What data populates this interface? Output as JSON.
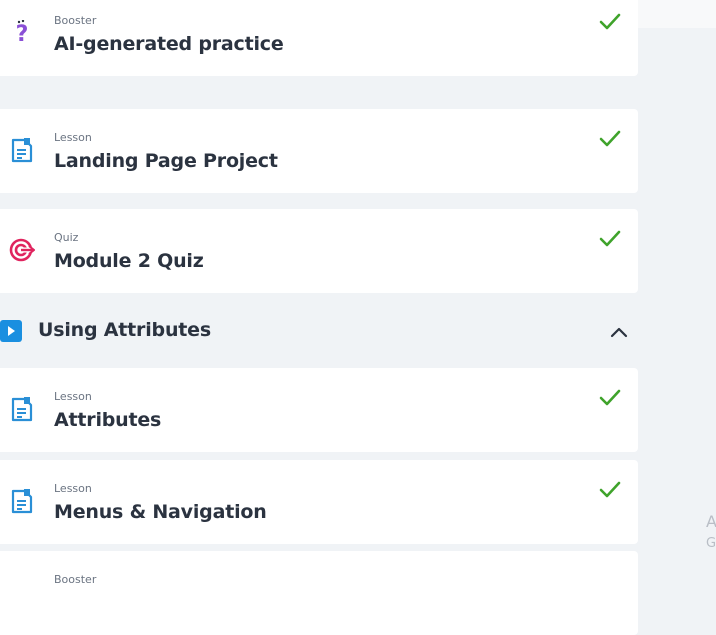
{
  "items": [
    {
      "type": "Booster",
      "title": "AI-generated practice"
    },
    {
      "type": "Lesson",
      "title": "Landing Page Project"
    },
    {
      "type": "Quiz",
      "title": "Module 2 Quiz"
    },
    {
      "type": "Lesson",
      "title": "Attributes"
    },
    {
      "type": "Lesson",
      "title": "Menus & Navigation"
    },
    {
      "type": "Booster",
      "title": ""
    }
  ],
  "section": {
    "title": "Using Attributes"
  },
  "side_text": {
    "line1": "A",
    "line2": "G"
  },
  "colors": {
    "background": "#f0f3f6",
    "card": "#ffffff",
    "check": "#3fa32b",
    "lesson_icon": "#2a8fd6",
    "quiz_icon": "#e0245e",
    "booster_icon": "#8a4fd6",
    "accent_orange": "#f7a51c",
    "section_play": "#1a8fe0"
  }
}
